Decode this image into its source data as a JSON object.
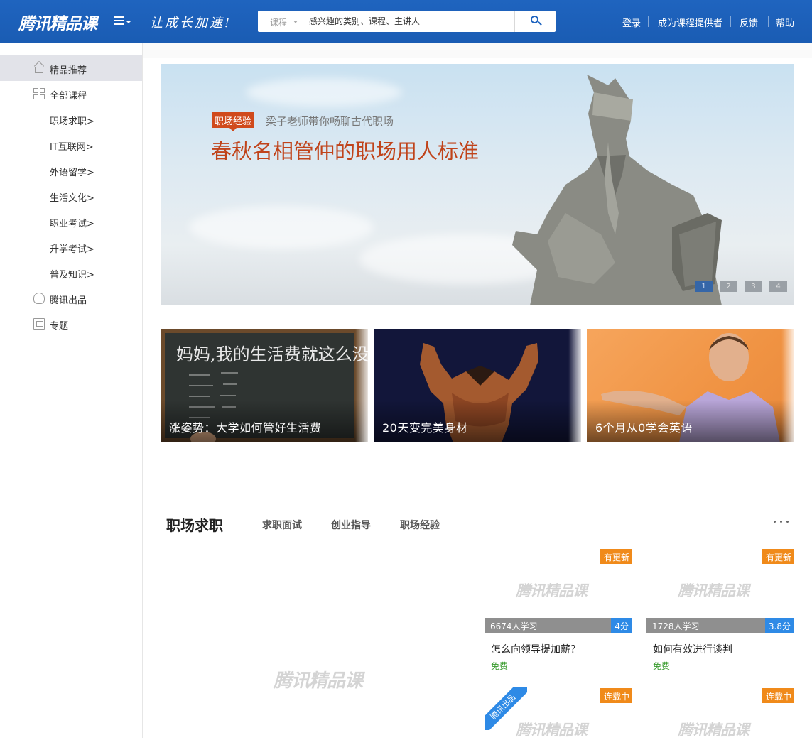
{
  "header": {
    "logo_text": "腾讯精品课",
    "slogan": "让成长加速!",
    "search": {
      "type_label": "课程",
      "placeholder": "感兴趣的类别、课程、主讲人"
    },
    "links": [
      "登录",
      "成为课程提供者",
      "反馈",
      "帮助"
    ]
  },
  "sidebar": {
    "items": [
      {
        "label": "精品推荐",
        "icon": "home-icon",
        "active": true
      },
      {
        "label": "全部课程",
        "icon": "grid-icon"
      },
      {
        "label": "职场求职>"
      },
      {
        "label": "IT互联网>"
      },
      {
        "label": "外语留学>"
      },
      {
        "label": "生活文化>"
      },
      {
        "label": "职业考试>"
      },
      {
        "label": "升学考试>"
      },
      {
        "label": "普及知识>"
      },
      {
        "label": "腾讯出品",
        "icon": "penguin-icon"
      },
      {
        "label": "专题",
        "icon": "topic-icon"
      }
    ]
  },
  "banner": {
    "tag": "职场经验",
    "subtitle": "梁子老师带你畅聊古代职场",
    "title": "春秋名相管仲的职场用人标准",
    "dots": [
      "1",
      "2",
      "3",
      "4"
    ],
    "active_dot": 0
  },
  "featured": [
    {
      "caption": "涨姿势：大学如何管好生活费",
      "chalk_text": "妈妈,我的生活费就这么没了"
    },
    {
      "caption": "20天变完美身材"
    },
    {
      "caption": "6个月从0学会英语"
    }
  ],
  "section": {
    "title": "职场求职",
    "tabs": [
      "求职面试",
      "创业指导",
      "职场经验"
    ],
    "placeholder_logo": "腾讯精品课",
    "courses": [
      {
        "badge": "有更新",
        "learners": "6674人学习",
        "score": "4分",
        "title": "怎么向领导提加薪？",
        "price": "免费"
      },
      {
        "badge": "有更新",
        "learners": "1728人学习",
        "score": "3.8分",
        "title": "如何有效进行谈判",
        "price": "免费"
      },
      {
        "badge": "连载中",
        "ribbon": "腾讯出品"
      },
      {
        "badge": "连载中"
      }
    ]
  },
  "colors": {
    "header_bg": "#1f64bf",
    "banner_title": "#c0431a",
    "badge_orange": "#f08a1a",
    "score_blue": "#2e8ae6",
    "free_green": "#3a9c2f"
  }
}
